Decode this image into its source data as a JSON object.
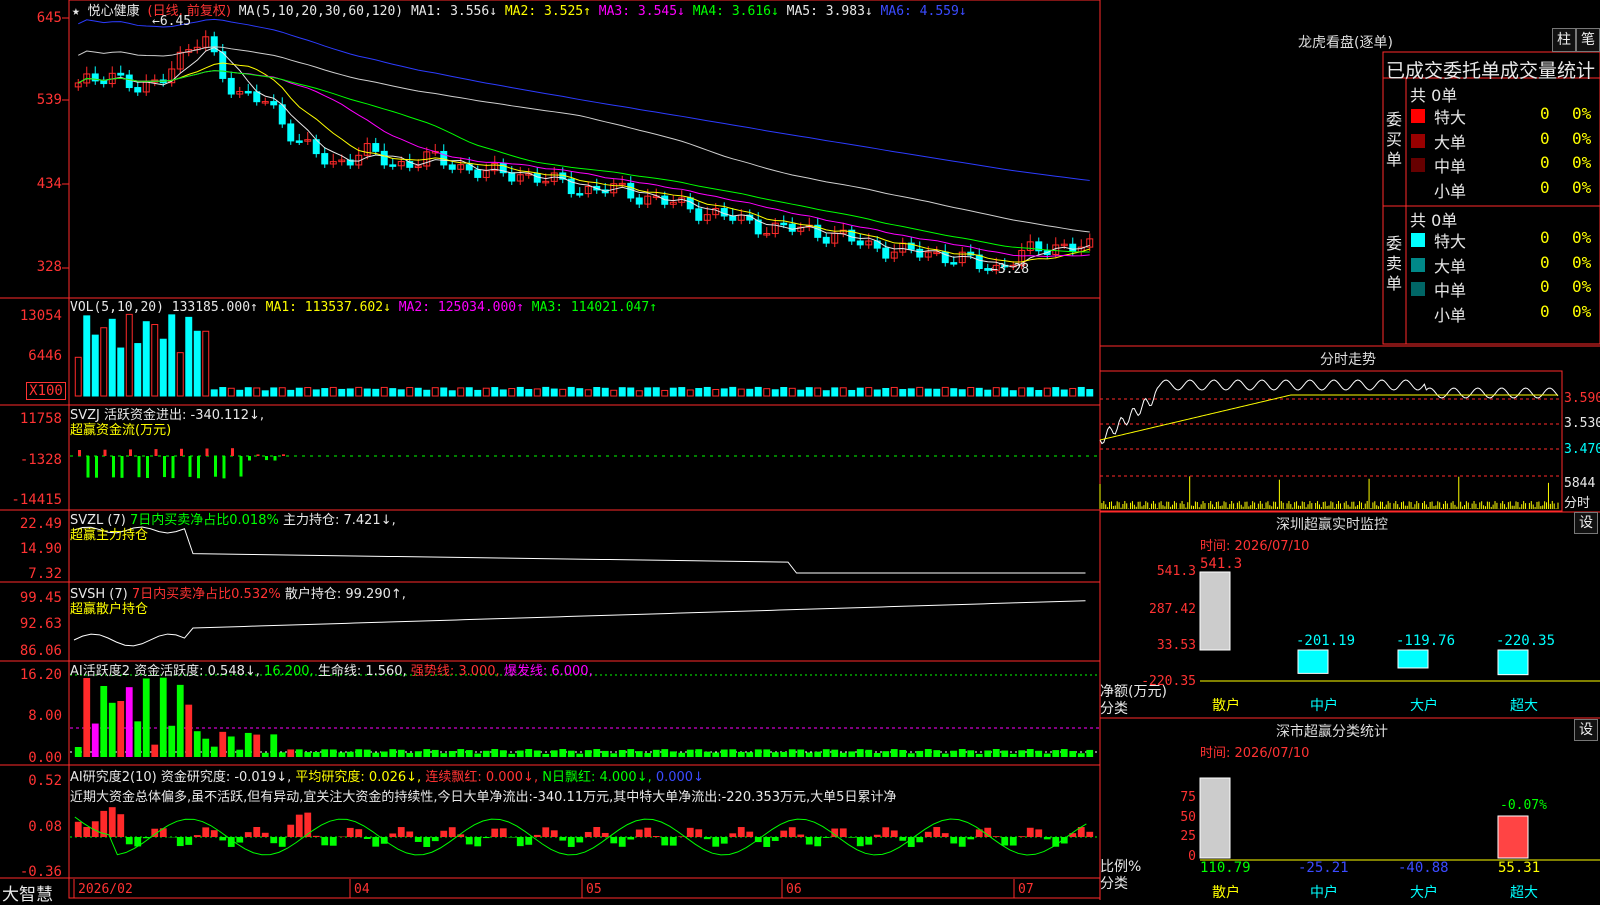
{
  "stock": {
    "name": "悦心健康",
    "period_label": "(日线, 前复权)",
    "high_marker": "6.45",
    "low_marker": "3.28"
  },
  "price_axis": [
    "645",
    "539",
    "434",
    "328"
  ],
  "ma_legend": [
    {
      "label": "MA(5,10,20,30,60,120)",
      "value": "",
      "color": "#e8e8e8"
    },
    {
      "label": "MA1:",
      "value": "3.556↓",
      "color": "#e8e8e8"
    },
    {
      "label": "MA2:",
      "value": "3.525↑",
      "color": "#ffff00"
    },
    {
      "label": "MA3:",
      "value": "3.545↓",
      "color": "#ff00ff"
    },
    {
      "label": "MA4:",
      "value": "3.616↓",
      "color": "#00ff00"
    },
    {
      "label": "MA5:",
      "value": "3.983↓",
      "color": "#e8e8e8"
    },
    {
      "label": "MA6:",
      "value": "4.559↓",
      "color": "#3b4bff"
    }
  ],
  "vol": {
    "title": "VOL(5,10,20)",
    "value": "133185.000↑",
    "ma1": "MA1: 113537.602↓",
    "ma2": "MA2: 125034.000↑",
    "ma3": "MA3: 114021.047↑",
    "axis": [
      "13054",
      "6446",
      "X100"
    ]
  },
  "svzj": {
    "title": "SVZJ  活跃资金进出: -340.112↓,",
    "subtitle": "超赢资金流(万元)",
    "axis": [
      "11758",
      "-1328",
      "-14415"
    ]
  },
  "svzl": {
    "title": "SVZL (7)",
    "extra": "7日内买卖净占比0.018%",
    "main": "主力持仓: 7.421↓,",
    "subtitle": "超赢主力持仓",
    "axis": [
      "22.49",
      "14.90",
      "7.32"
    ]
  },
  "svsh": {
    "title": "SVSH (7)",
    "extra": "7日内买卖净占比0.532%",
    "main": "散户持仓: 99.290↑,",
    "subtitle": "超赢散户持仓",
    "axis": [
      "99.45",
      "92.63",
      "86.06"
    ]
  },
  "ai_active": {
    "title": "AI活跃度2",
    "v1": "资金活跃度: 0.548↓,",
    "v2": "16.200,",
    "v3": "生命线: 1.560,",
    "v4": "强势线: 3.000,",
    "v5": "爆发线: 6.000,",
    "axis": [
      "16.20",
      "8.00",
      "0.00"
    ]
  },
  "ai_research": {
    "title": "AI研究度2(10)",
    "v1": "资金研究度: -0.019↓,",
    "v2": "平均研究度: 0.026↓,",
    "v3": "连续飘红: 0.000↓,",
    "v4": "N日飘红: 4.000↓,",
    "v5": "0.000↓",
    "commentary": "近期大资金总体偏多,虽不活跃,但有异动,宜关注大资金的持续性,今日大单净流出:-340.11万元,其中特大单净流出:-220.353万元,大单5日累计净",
    "axis": [
      "0.52",
      "0.08",
      "-0.36"
    ]
  },
  "bottom_bar": {
    "brand": "大智慧",
    "dates": [
      "2026/02",
      "04",
      "05",
      "06",
      "07"
    ]
  },
  "dragon_tiger": {
    "title": "龙虎看盘(逐单)",
    "btn_bar": "柱",
    "btn_pen": "笔",
    "header": "已成交委托单成交量统计",
    "buy_label": "委买单",
    "sell_label": "委卖单",
    "buy_total": "共 0单",
    "sell_total": "共 0单",
    "buy_rows": [
      {
        "name": "特大",
        "count": "0",
        "pct": "0%",
        "color": "#ff0000"
      },
      {
        "name": "大单",
        "count": "0",
        "pct": "0%",
        "color": "#990000"
      },
      {
        "name": "中单",
        "count": "0",
        "pct": "0%",
        "color": "#660000"
      },
      {
        "name": "小单",
        "count": "0",
        "pct": "0%",
        "color": "#000000"
      }
    ],
    "sell_rows": [
      {
        "name": "特大",
        "count": "0",
        "pct": "0%",
        "color": "#00ffff"
      },
      {
        "name": "大单",
        "count": "0",
        "pct": "0%",
        "color": "#008888"
      },
      {
        "name": "中单",
        "count": "0",
        "pct": "0%",
        "color": "#006666"
      },
      {
        "name": "小单",
        "count": "0",
        "pct": "0%",
        "color": "#000000"
      }
    ]
  },
  "intraday": {
    "title": "分时走势",
    "axis": [
      "3.590",
      "3.530",
      "3.470"
    ],
    "vol_axis": [
      "5844",
      "分时"
    ]
  },
  "sz_monitor": {
    "title": "深圳超赢实时监控",
    "btn": "设",
    "time": "时间: 2026/07/10",
    "axis": [
      "541.3",
      "287.42",
      "33.53",
      "-220.35"
    ],
    "y_label": "净额(万元)",
    "x_label": "分类",
    "categories": [
      "散户",
      "中户",
      "大户",
      "超大"
    ],
    "values": [
      541.3,
      -201.19,
      -119.76,
      -220.35
    ],
    "value_labels": [
      "541.3",
      "-201.19",
      "-119.76",
      "-220.35"
    ]
  },
  "sz_class": {
    "title": "深市超赢分类统计",
    "btn": "设",
    "time": "时间: 2026/07/10",
    "axis": [
      "75",
      "50",
      "25",
      "0"
    ],
    "y_label": "比例%",
    "x_label": "分类",
    "categories": [
      "散户",
      "中户",
      "大户",
      "超大"
    ],
    "values": [
      110.79,
      -25.21,
      -40.88,
      55.31
    ],
    "value_labels": [
      "110.79",
      "-25.21",
      "-40.88",
      "55.31"
    ],
    "top_label": "-0.07%"
  },
  "chart_data": {
    "type": "candlestick",
    "title": "悦心健康 (日线, 前复权)",
    "x_ticks": [
      "2026/02",
      "04",
      "05",
      "06",
      "07"
    ],
    "price_range": [
      3.28,
      6.45
    ],
    "approx_close_series": [
      5.6,
      5.8,
      5.5,
      5.9,
      6.2,
      5.5,
      5.4,
      4.9,
      4.6,
      4.8,
      4.6,
      4.7,
      4.6,
      4.5,
      4.5,
      4.4,
      4.3,
      4.3,
      4.2,
      4.1,
      4.0,
      3.9,
      3.8,
      3.8,
      3.7,
      3.6,
      3.5,
      3.5,
      3.4,
      3.3,
      3.5,
      3.6,
      3.55
    ]
  }
}
